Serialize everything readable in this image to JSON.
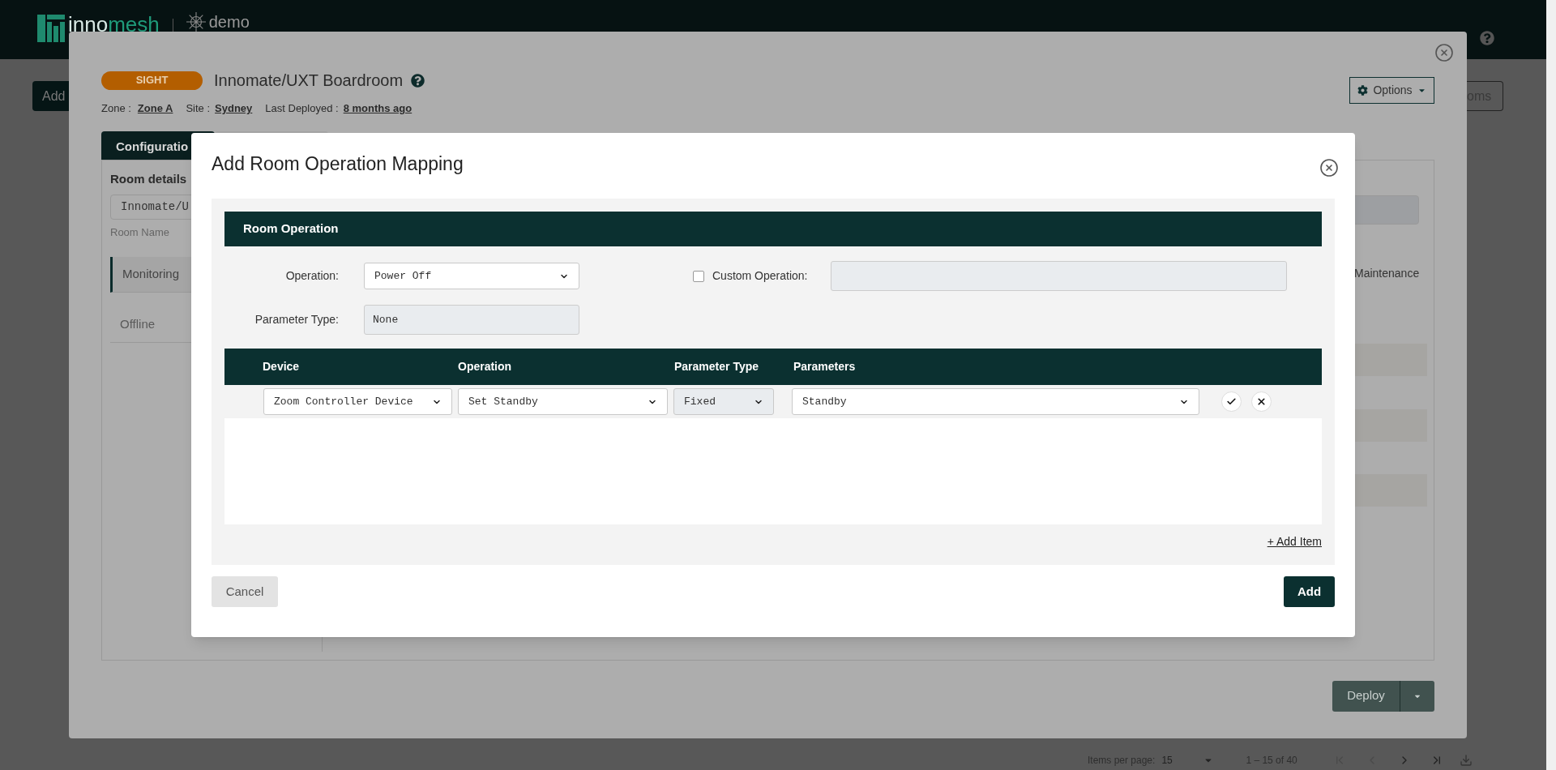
{
  "header": {
    "brand_parts": [
      "inno",
      "mesh"
    ],
    "tenant": "demo"
  },
  "page": {
    "add_button": "Add",
    "rooms_button": "oms",
    "pagination": {
      "items_per_page_label": "Items per page:",
      "items_per_page": "15",
      "range": "1 – 15 of 40"
    }
  },
  "room_modal": {
    "badge": "SIGHT",
    "title": "Innomate/UXT Boardroom",
    "zone_label": "Zone :",
    "zone": "Zone A",
    "site_label": "Site :",
    "site": "Sydney",
    "last_deployed_label": "Last Deployed :",
    "last_deployed": "8 months ago",
    "options": "Options",
    "tab": "Configuratio",
    "room_details": "Room details",
    "room_name_value": "Innomate/U",
    "room_name_label": "Room Name",
    "nav_items": [
      {
        "label": "Monitoring",
        "selected": true
      },
      {
        "label": "Offline",
        "selected": false
      }
    ],
    "status": "Maintenance",
    "deploy": "Deploy"
  },
  "dialog": {
    "title": "Add Room Operation Mapping",
    "section": "Room Operation",
    "operation_label": "Operation:",
    "operation": "Power Off",
    "custom_operation": {
      "label": "Custom Operation:",
      "checked": false
    },
    "parameter_type_label": "Parameter Type:",
    "parameter_type": "None",
    "columns": [
      "Device",
      "Operation",
      "Parameter Type",
      "Parameters"
    ],
    "rows": [
      {
        "device": "Zoom Controller Device",
        "operation": "Set Standby",
        "parameter_type": "Fixed",
        "parameters": "Standby"
      }
    ],
    "add_item": "+ Add Item",
    "cancel": "Cancel",
    "add": "Add"
  }
}
